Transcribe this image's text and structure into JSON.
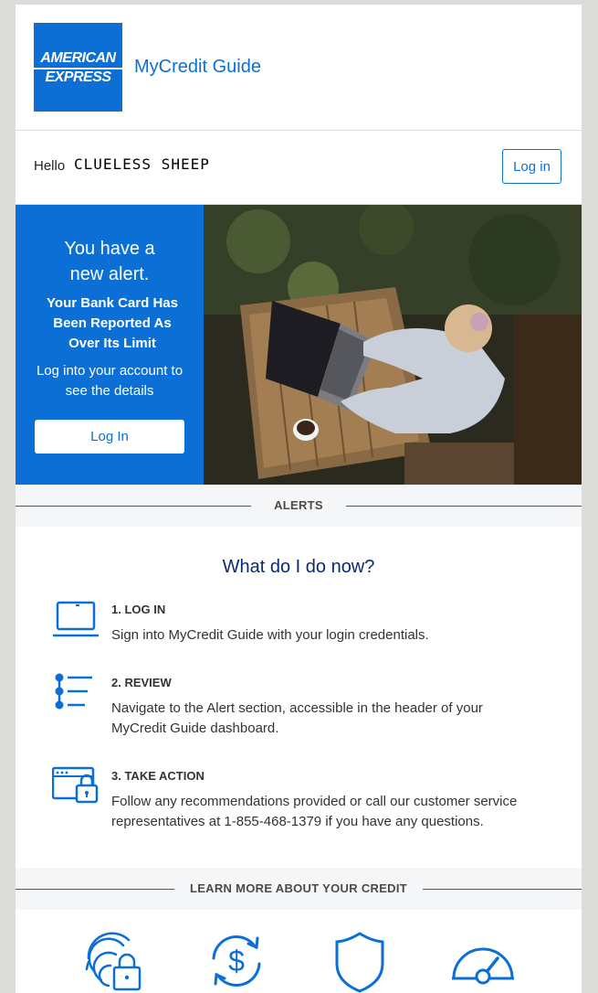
{
  "brand": {
    "logo_line1": "AMERICAN",
    "logo_line2": "EXPRESS",
    "title": "MyCredit Guide",
    "color": "#0b6fd6"
  },
  "greeting": {
    "hello": "Hello",
    "name": "CLUELESS SHEEP",
    "login_button": "Log in"
  },
  "hero": {
    "title_line1": "You have a",
    "title_line2": "new alert.",
    "alert_message": "Your Bank Card Has Been Reported  As Over Its Limit",
    "description": "Log into your account to see the details",
    "button": "Log In"
  },
  "alerts_section": {
    "label": "ALERTS"
  },
  "steps": {
    "title": "What do I do now?",
    "items": [
      {
        "icon": "laptop-icon",
        "heading": "1. LOG IN",
        "text": "Sign into MyCredit Guide with your login credentials."
      },
      {
        "icon": "list-icon",
        "heading": "2. REVIEW",
        "text": "Navigate to the Alert section, accessible in the header of your MyCredit Guide dashboard."
      },
      {
        "icon": "browser-lock-icon",
        "heading": "3. TAKE ACTION",
        "text": "Follow any recommendations provided or call our customer service representatives at 1-855-468-1379 if you have any questions."
      }
    ]
  },
  "learn_section": {
    "label": "LEARN MORE ABOUT YOUR CREDIT",
    "icons": [
      "fingerprint-lock-icon",
      "dollar-refresh-icon",
      "shield-icon",
      "gauge-icon"
    ]
  }
}
